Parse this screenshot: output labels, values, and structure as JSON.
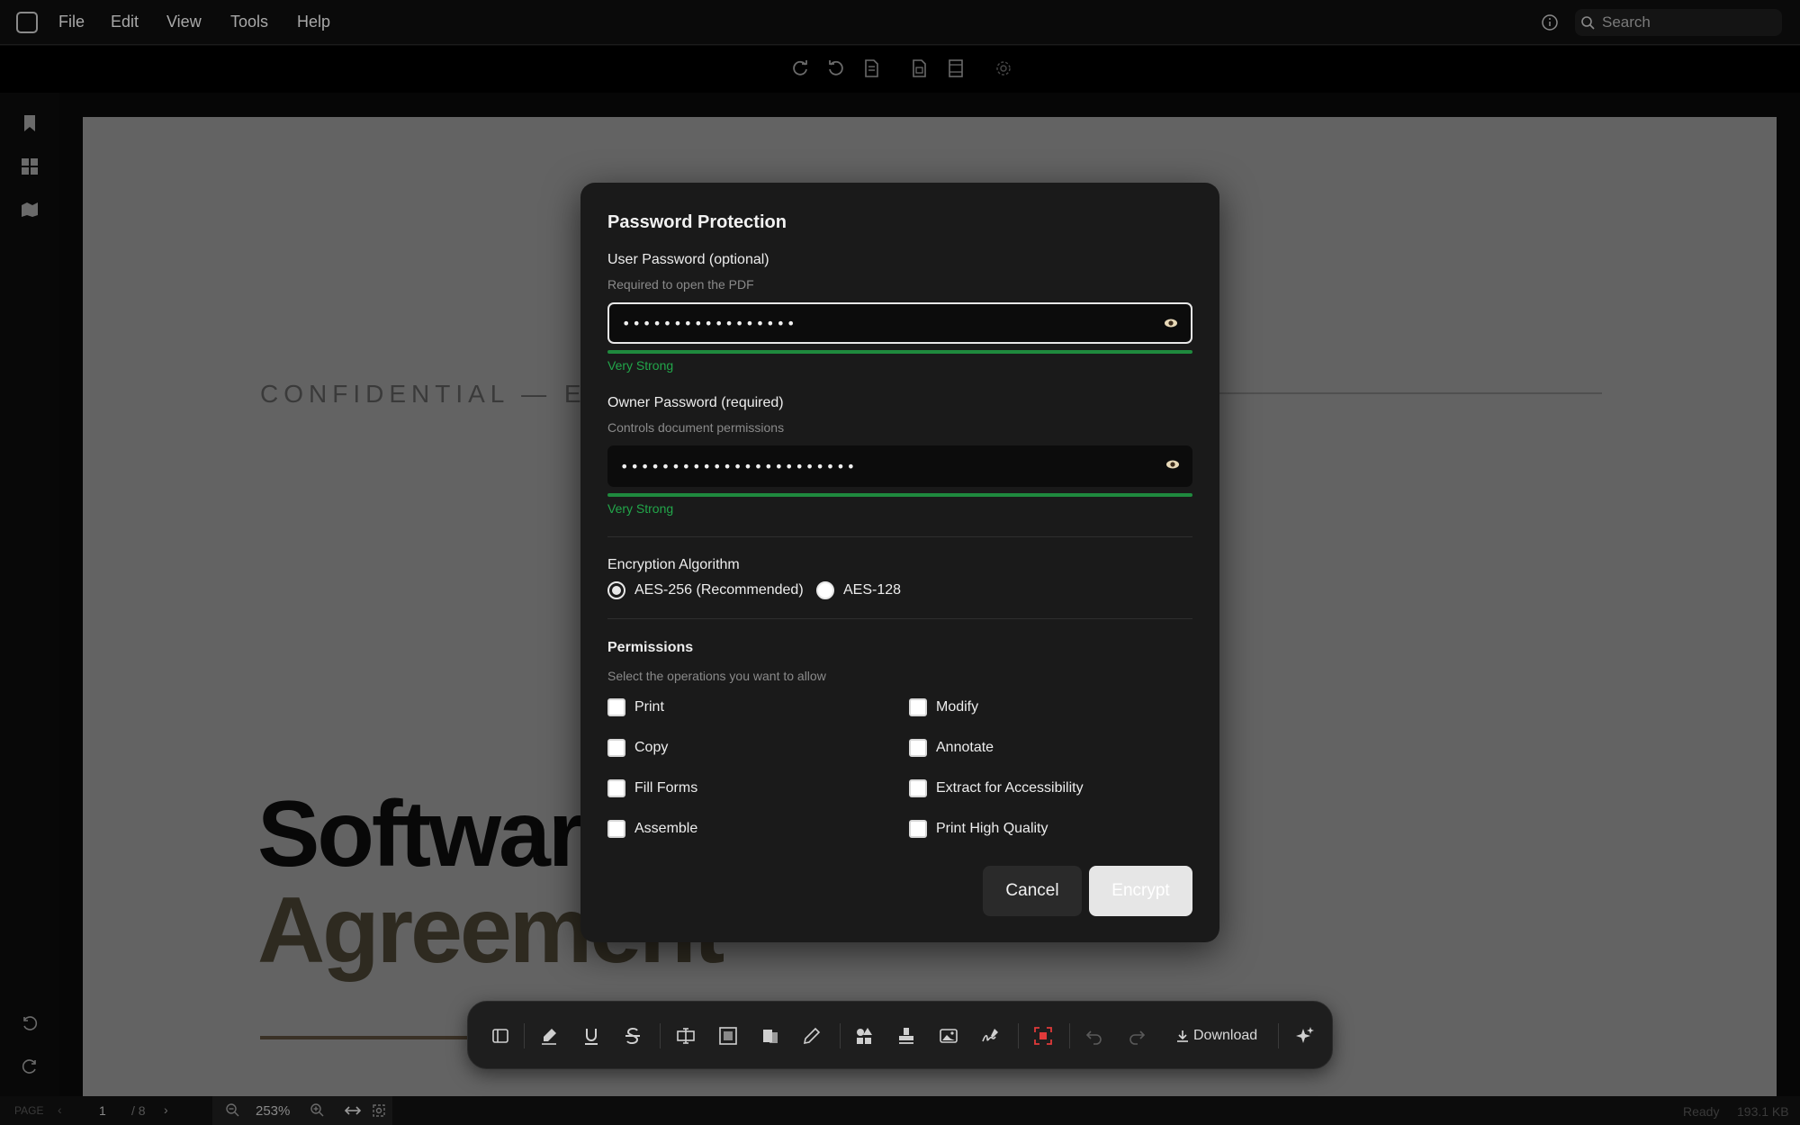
{
  "menubar": {
    "items": [
      "File",
      "Edit",
      "View",
      "Tools",
      "Help"
    ],
    "search_placeholder": "Search"
  },
  "document": {
    "confidential_line": "CONFIDENTIAL — EXE",
    "title_line1": "Software",
    "title_line2": "Agreement"
  },
  "status": {
    "page_label": "PAGE",
    "page_current": "1",
    "page_total": "/ 8",
    "zoom": "253%",
    "state": "Ready",
    "size": "193.1 KB"
  },
  "dialog": {
    "title": "Password Protection",
    "user_password": {
      "label": "User Password (optional)",
      "hint": "Required to open the PDF",
      "value": "•••••••••••••••••",
      "strength": "Very Strong",
      "strength_color": "#22a64a"
    },
    "owner_password": {
      "label": "Owner Password (required)",
      "hint": "Controls document permissions",
      "value": "•••••••••••••••••••••••",
      "strength": "Very Strong",
      "strength_color": "#22a64a"
    },
    "encryption": {
      "label": "Encryption Algorithm",
      "options": [
        "AES-256 (Recommended)",
        "AES-128"
      ],
      "selected": "AES-256 (Recommended)"
    },
    "permissions": {
      "label": "Permissions",
      "hint": "Select the operations you want to allow",
      "items": [
        "Print",
        "Modify",
        "Copy",
        "Annotate",
        "Fill Forms",
        "Extract for Accessibility",
        "Assemble",
        "Print High Quality"
      ]
    },
    "cancel_label": "Cancel",
    "encrypt_label": "Encrypt"
  },
  "float_toolbar": {
    "download_label": "Download"
  },
  "colors": {
    "accent_red": "#e03a3a",
    "strength_green": "#22a64a"
  }
}
